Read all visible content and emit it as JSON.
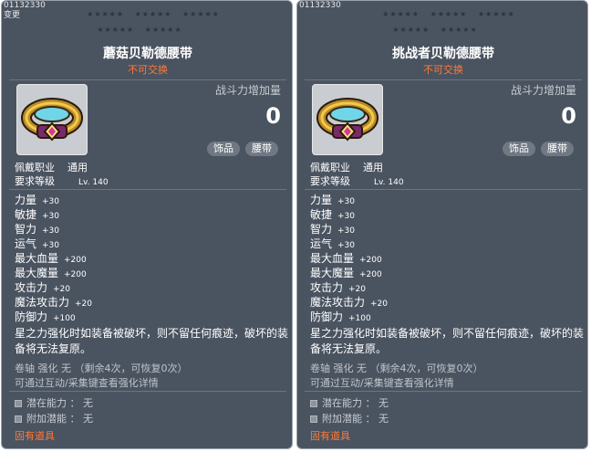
{
  "panels": [
    {
      "id_text": "01132330",
      "sub_id": "变更",
      "star_row1": [
        "★★★★★",
        "★★★★★",
        "★★★★★"
      ],
      "star_row2": [
        "★★★★★",
        "★★★★★"
      ],
      "title": "蘑菇贝勒德腰带",
      "subtitle": "不可交换",
      "power_label": "战斗力增加量",
      "power_value": "0",
      "tags": [
        "饰品",
        "腰带"
      ],
      "job_label": "佩戴职业",
      "job_value": "通用",
      "level_label": "要求等级",
      "level_value": "Lv. 140",
      "stats": [
        {
          "label": "力量",
          "value": "+30"
        },
        {
          "label": "敏捷",
          "value": "+30"
        },
        {
          "label": "智力",
          "value": "+30"
        },
        {
          "label": "运气",
          "value": "+30"
        },
        {
          "label": "最大血量",
          "value": "+200"
        },
        {
          "label": "最大魔量",
          "value": "+200"
        },
        {
          "label": "攻击力",
          "value": "+20"
        },
        {
          "label": "魔法攻击力",
          "value": "+20"
        },
        {
          "label": "防御力",
          "value": "+100"
        }
      ],
      "desc_line1": "星之力强化时如装备被破坏，则不留任何痕迹，破坏的装",
      "desc_line2": "备将无法复原。",
      "scroll_line": "卷轴  强化  无  （剩余4次，可恢复0次）",
      "enhance_line": "可通过互动/采集键查看强化详情",
      "potential": "潜在能力 ： 无",
      "bonus_potential": "附加潜能 ： 无",
      "footer": "固有道具"
    },
    {
      "id_text": "01132330",
      "star_row1": [
        "★★★★★",
        "★★★★★",
        "★★★★★"
      ],
      "star_row2": [
        "★★★★★",
        "★★★★★"
      ],
      "title": "挑战者贝勒德腰带",
      "subtitle": "不可交换",
      "power_label": "战斗力增加量",
      "power_value": "0",
      "tags": [
        "饰品",
        "腰带"
      ],
      "job_label": "佩戴职业",
      "job_value": "通用",
      "level_label": "要求等级",
      "level_value": "Lv. 140",
      "stats": [
        {
          "label": "力量",
          "value": "+30"
        },
        {
          "label": "敏捷",
          "value": "+30"
        },
        {
          "label": "智力",
          "value": "+30"
        },
        {
          "label": "运气",
          "value": "+30"
        },
        {
          "label": "最大血量",
          "value": "+200"
        },
        {
          "label": "最大魔量",
          "value": "+200"
        },
        {
          "label": "攻击力",
          "value": "+20"
        },
        {
          "label": "魔法攻击力",
          "value": "+20"
        },
        {
          "label": "防御力",
          "value": "+100"
        }
      ],
      "desc_line1": "星之力强化时如装备被破坏，则不留任何痕迹，破坏的装",
      "desc_line2": "备将无法复原。",
      "scroll_line": "卷轴  强化  无  （剩余4次，可恢复0次）",
      "enhance_line": "可通过互动/采集键查看强化详情",
      "potential": "潜在能力 ： 无",
      "bonus_potential": "附加潜能 ： 无",
      "footer": "固有道具"
    }
  ],
  "colors": {
    "panel_bg": "#4a5360",
    "untradeable": "#ff7a3a",
    "tag_bg": "#707983"
  },
  "icons": {
    "item": "belt-icon",
    "bullet": "square-bullet-icon",
    "star": "star-icon"
  }
}
